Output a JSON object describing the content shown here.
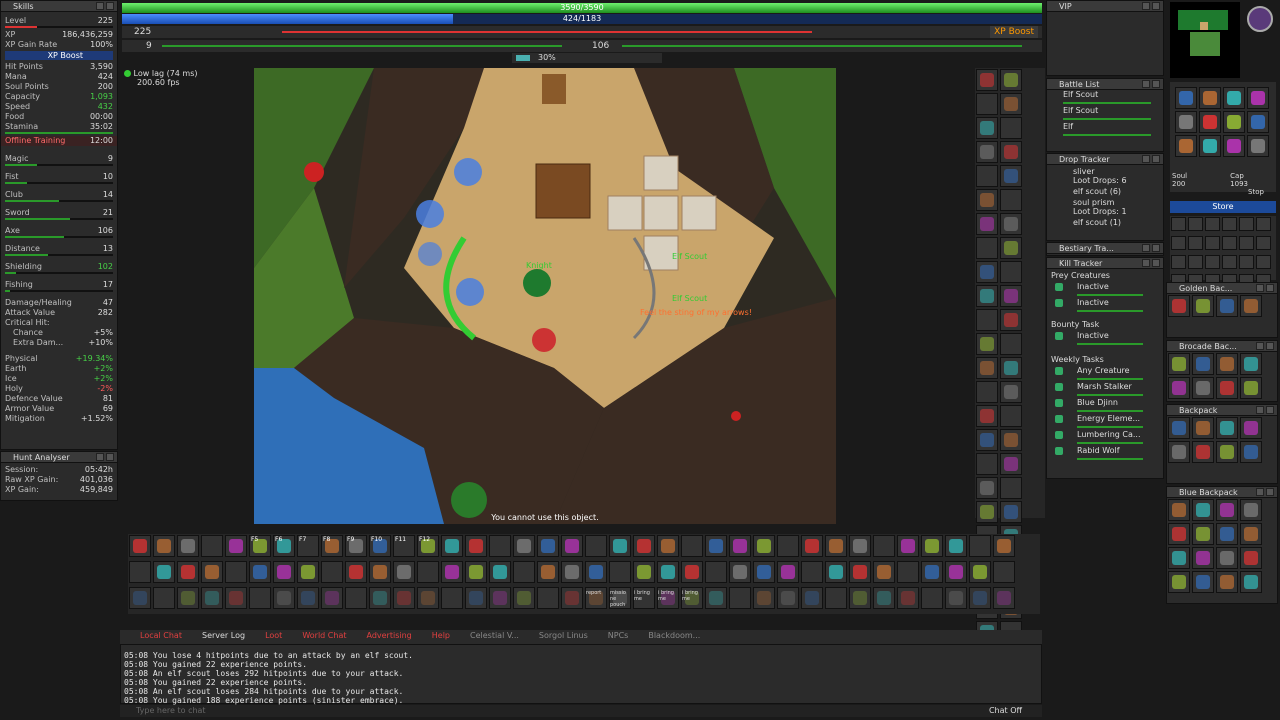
{
  "skills": {
    "title": "Skills",
    "level": {
      "label": "Level",
      "value": "225"
    },
    "xp": {
      "label": "XP",
      "value": "186,436,259"
    },
    "xp_gain_rate": {
      "label": "XP Gain Rate",
      "value": "100%"
    },
    "xp_boost": "XP Boost",
    "hit_points": {
      "label": "Hit Points",
      "value": "3,590"
    },
    "mana": {
      "label": "Mana",
      "value": "424"
    },
    "soul_points": {
      "label": "Soul Points",
      "value": "200"
    },
    "capacity": {
      "label": "Capacity",
      "value": "1,093"
    },
    "speed": {
      "label": "Speed",
      "value": "432"
    },
    "food": {
      "label": "Food",
      "value": "00:00"
    },
    "stamina": {
      "label": "Stamina",
      "value": "35:02"
    },
    "offline_training": {
      "label": "Offline Training",
      "value": "12:00"
    },
    "list": [
      {
        "label": "Magic",
        "value": "9",
        "progress": 0.3
      },
      {
        "label": "Fist",
        "value": "10",
        "progress": 0.2
      },
      {
        "label": "Club",
        "value": "14",
        "progress": 0.5
      },
      {
        "label": "Sword",
        "value": "21",
        "progress": 0.6
      },
      {
        "label": "Axe",
        "value": "106",
        "progress": 0.55
      },
      {
        "label": "Distance",
        "value": "13",
        "progress": 0.4
      },
      {
        "label": "Shielding",
        "value": "102",
        "progress": 0.1
      },
      {
        "label": "Fishing",
        "value": "17",
        "progress": 0.05
      }
    ],
    "damage_healing": {
      "label": "Damage/Healing",
      "value": "47"
    },
    "attack_value": {
      "label": "Attack Value",
      "value": "282"
    },
    "critical_hit": {
      "label": "Critical Hit:"
    },
    "chance": {
      "label": "Chance",
      "value": "+5%"
    },
    "extra_damage": {
      "label": "Extra Dam...",
      "value": "+10%"
    },
    "physical": {
      "label": "Physical",
      "value": "+19.34%"
    },
    "earth": {
      "label": "Earth",
      "value": "+2%"
    },
    "ice": {
      "label": "Ice",
      "value": "+2%"
    },
    "holy": {
      "label": "Holy",
      "value": "-2%"
    },
    "defence_value": {
      "label": "Defence Value",
      "value": "81"
    },
    "armor_value": {
      "label": "Armor Value",
      "value": "69"
    },
    "mitigation": {
      "label": "Mitigation",
      "value": "+1.52%"
    }
  },
  "hunt_analyser": {
    "title": "Hunt Analyser",
    "session": {
      "label": "Session:",
      "value": "05:42h"
    },
    "raw_xp_gain": {
      "label": "Raw XP Gain:",
      "value": "401,036"
    },
    "xp_gain": {
      "label": "XP Gain:",
      "value": "459,849"
    }
  },
  "status": {
    "hp": "3590/3590",
    "mana": "424/1183",
    "mana_fraction": 0.36,
    "level": "225",
    "xp_boost": "XP Boost",
    "magic_level": "9",
    "skill_value": "106",
    "percent": "30%",
    "lag": "Low lag (74 ms)",
    "fps": "200.60 fps"
  },
  "game": {
    "message": "You cannot use this object.",
    "creature_names": [
      "Elf Scout",
      "Elf Scout"
    ],
    "player_name": "Knight",
    "battle_cry": "Feel the sting of my arrows!"
  },
  "battle_list": {
    "title": "Battle List",
    "items": [
      "Elf Scout",
      "Elf Scout",
      "Elf"
    ]
  },
  "drop_tracker": {
    "title": "Drop Tracker",
    "items": [
      {
        "name": "sliver",
        "info": "Loot Drops: 6"
      },
      {
        "name": "elf scout (6)",
        "info": ""
      },
      {
        "name": "soul prism",
        "info": "Loot Drops: 1"
      },
      {
        "name": "elf scout (1)",
        "info": ""
      }
    ]
  },
  "bestiary_title": "Bestiary Tra...",
  "kill_tracker": {
    "title": "Kill Tracker",
    "prey_title": "Prey Creatures",
    "prey": [
      "Inactive",
      "Inactive"
    ],
    "bounty_title": "Bounty Task",
    "bounty": [
      "Inactive"
    ],
    "weekly_title": "Weekly Tasks",
    "weekly": [
      "Any Creature",
      "Marsh Stalker",
      "Blue Djinn",
      "Energy Eleme...",
      "Lumbering Ca...",
      "Rabid Wolf"
    ]
  },
  "right": {
    "vip": "VIP",
    "store": "Store",
    "stop": "Stop",
    "soul": "Soul",
    "soul_value": "200",
    "cap": "Cap",
    "cap_value": "1093",
    "containers": [
      "Golden Bac...",
      "Brocade Bac...",
      "Backpack",
      "Blue Backpack"
    ]
  },
  "hotkeys": {
    "labels": [
      "F5",
      "F6",
      "F7",
      "F8",
      "F9",
      "F10",
      "F11",
      "F12"
    ],
    "extra": [
      "report",
      "missio ne pouch",
      "i bring me",
      "i bring me",
      "i bring me"
    ]
  },
  "chat_tabs": [
    "Local Chat",
    "Server Log",
    "Loot",
    "World Chat",
    "Advertising",
    "Help",
    "Celestial V...",
    "Sorgol Linus",
    "NPCs",
    "Blackdoom..."
  ],
  "console": [
    "05:08 You lose 4 hitpoints due to an attack by an elf scout.",
    "05:08 You gained 22 experience points.",
    "05:08 An elf scout loses 292 hitpoints due to your attack.",
    "05:08 You gained 22 experience points.",
    "05:08 An elf scout loses 284 hitpoints due to your attack.",
    "05:08 You gained 188 experience points (sinister embrace)."
  ],
  "chat_input_placeholder": "Type here to chat",
  "chat_off": "Chat Off"
}
